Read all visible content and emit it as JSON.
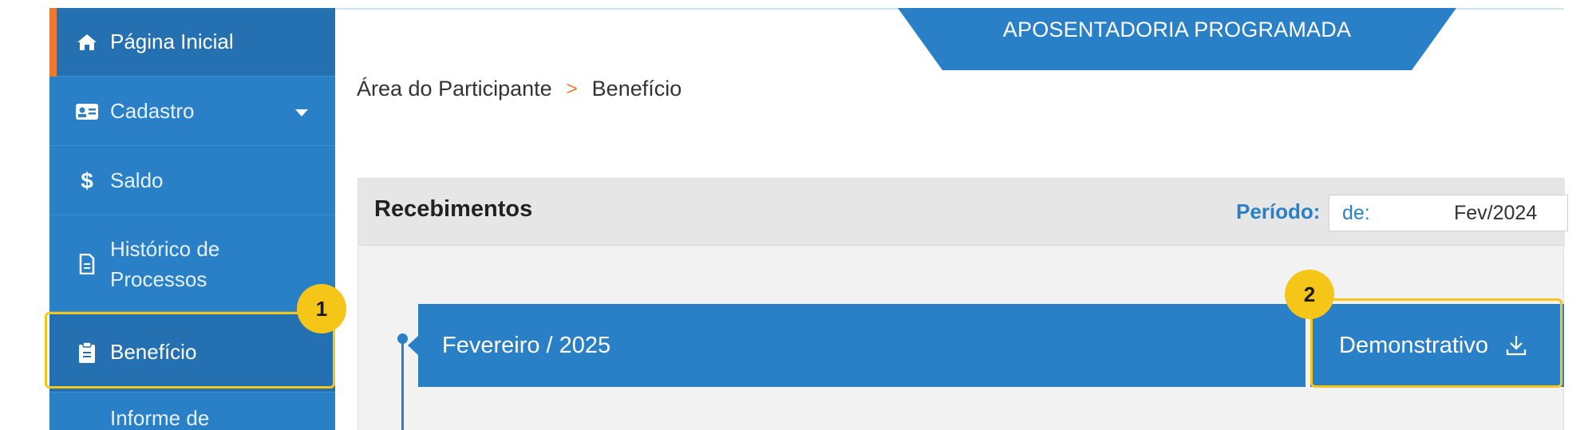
{
  "sidebar": {
    "items": [
      {
        "label": "Página Inicial",
        "icon": "home-icon"
      },
      {
        "label": "Cadastro",
        "icon": "id-card-icon"
      },
      {
        "label": "Saldo",
        "icon": "dollar-icon"
      },
      {
        "label": "Histórico de Processos",
        "icon": "document-icon"
      },
      {
        "label": "Benefício",
        "icon": "clipboard-icon"
      },
      {
        "label": "Informe de",
        "icon": "document-icon"
      }
    ]
  },
  "banner": {
    "title": "APOSENTADORIA PROGRAMADA"
  },
  "breadcrumb": {
    "root": "Área do Participante",
    "separator": ">",
    "current": "Benefício"
  },
  "panel": {
    "title": "Recebimentos",
    "period_label": "Período:",
    "period_prefix": "de:",
    "period_value": "Fev/2024"
  },
  "timeline": {
    "entry_label": "Fevereiro / 2025",
    "action_label": "Demonstrativo"
  },
  "callouts": {
    "first": "1",
    "second": "2"
  },
  "colors": {
    "primary": "#2a80c6",
    "accent": "#ec7a32",
    "highlight": "#f5c518"
  }
}
